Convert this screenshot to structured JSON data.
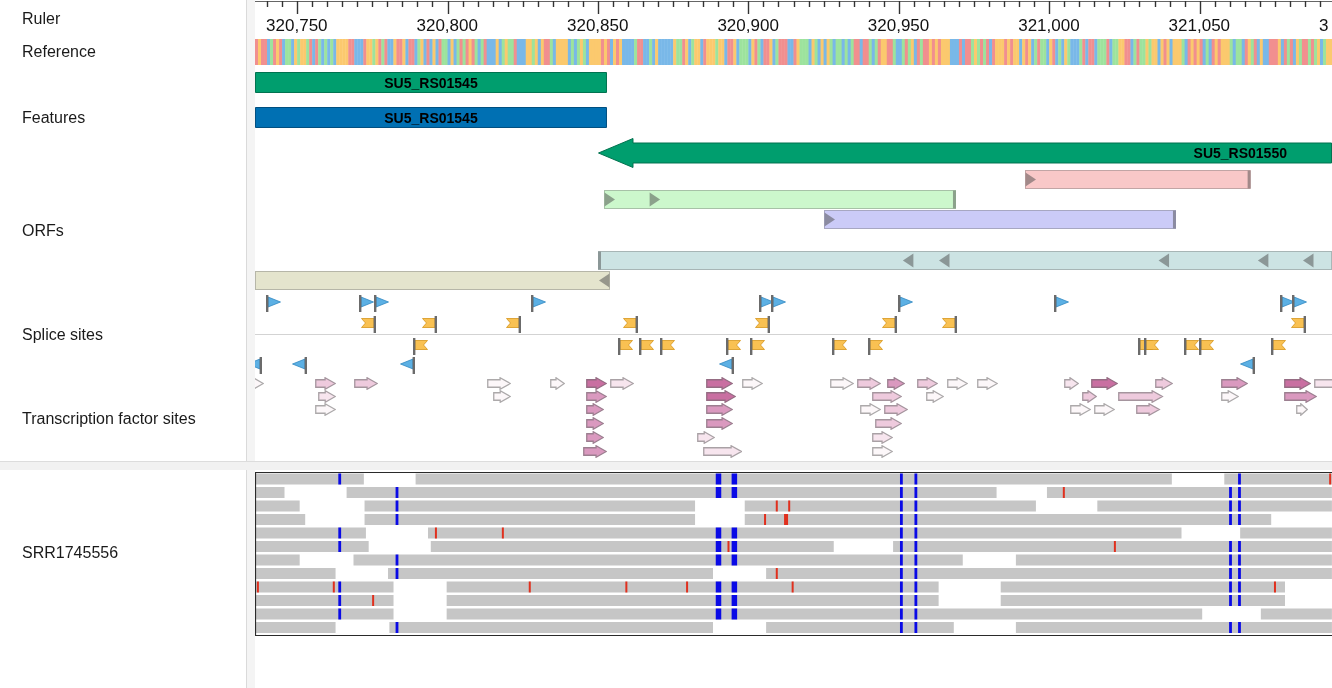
{
  "tracks": [
    {
      "kind": "ruler",
      "label": "Ruler",
      "ticks": [
        "320,750",
        "320,800",
        "320,850",
        "320,900",
        "320,950",
        "321,000",
        "321,050",
        "3"
      ]
    },
    {
      "kind": "reference",
      "label": "Reference"
    },
    {
      "kind": "features",
      "label": "Features",
      "features": [
        {
          "kind": "gene",
          "label": "SU5_RS01545",
          "reverse": true
        },
        {
          "kind": "cds",
          "label": "SU5_RS01545",
          "reverse": true
        },
        {
          "kind": "gene",
          "label": "SU5_RS01550",
          "reverse": true
        }
      ]
    },
    {
      "kind": "orfs",
      "label": "ORFs",
      "orfs": [
        {
          "color": "#f9c8c8",
          "reverse": false
        },
        {
          "color": "#ccf7cc",
          "reverse": false
        },
        {
          "color": "#cbcbf7",
          "reverse": false
        },
        {
          "color": "#cce3e3",
          "reverse": true
        },
        {
          "color": "#e4e4cd",
          "reverse": true
        }
      ]
    },
    {
      "kind": "splice_sites",
      "label": "Splice sites",
      "sites": [
        {
          "kind": "pennant",
          "reverse": false
        },
        {
          "kind": "pennant",
          "reverse": false
        },
        {
          "kind": "pennant",
          "reverse": false
        },
        {
          "kind": "pennant",
          "reverse": false
        },
        {
          "kind": "pennant",
          "reverse": false
        },
        {
          "kind": "pennant",
          "reverse": false
        },
        {
          "kind": "pennant",
          "reverse": false
        },
        {
          "kind": "pennant",
          "reverse": false
        },
        {
          "kind": "pennant",
          "reverse": false
        },
        {
          "kind": "pennant",
          "reverse": false
        },
        {
          "kind": "swallowtail",
          "reverse": false
        },
        {
          "kind": "swallowtail",
          "reverse": false
        },
        {
          "kind": "swallowtail",
          "reverse": false
        },
        {
          "kind": "swallowtail",
          "reverse": false
        },
        {
          "kind": "swallowtail",
          "reverse": false
        },
        {
          "kind": "swallowtail",
          "reverse": false
        },
        {
          "kind": "swallowtail",
          "reverse": false
        },
        {
          "kind": "swallowtail",
          "reverse": false
        },
        {
          "kind": "swallowtail",
          "reverse": true
        },
        {
          "kind": "swallowtail",
          "reverse": true
        },
        {
          "kind": "swallowtail",
          "reverse": true
        },
        {
          "kind": "swallowtail",
          "reverse": true
        },
        {
          "kind": "swallowtail",
          "reverse": true
        },
        {
          "kind": "swallowtail",
          "reverse": true
        },
        {
          "kind": "swallowtail",
          "reverse": true
        },
        {
          "kind": "swallowtail",
          "reverse": true
        },
        {
          "kind": "swallowtail",
          "reverse": true
        },
        {
          "kind": "swallowtail",
          "reverse": true
        },
        {
          "kind": "swallowtail",
          "reverse": true
        },
        {
          "kind": "swallowtail",
          "reverse": true
        },
        {
          "kind": "swallowtail",
          "reverse": true
        },
        {
          "kind": "pennant",
          "reverse": true
        },
        {
          "kind": "pennant",
          "reverse": true
        },
        {
          "kind": "pennant",
          "reverse": true
        },
        {
          "kind": "pennant",
          "reverse": true
        },
        {
          "kind": "pennant",
          "reverse": true
        }
      ]
    },
    {
      "kind": "tf_sites",
      "label": "Transcription factor sites",
      "sites": [
        {
          "color": "#fcf7f9"
        },
        {
          "color": "#eecadd"
        },
        {
          "color": "#eecadd"
        },
        {
          "color": "#fcf7f9"
        },
        {
          "color": "#fcf7f9"
        },
        {
          "color": "#c96fa1"
        },
        {
          "color": "#f7e5ee"
        },
        {
          "color": "#c96fa1"
        },
        {
          "color": "#fcf7f9"
        },
        {
          "color": "#fcf7f9"
        },
        {
          "color": "#eecadd"
        },
        {
          "color": "#da99bf"
        },
        {
          "color": "#eecadd"
        },
        {
          "color": "#fcf7f9"
        },
        {
          "color": "#fcf7f9"
        },
        {
          "color": "#f7e5ee"
        },
        {
          "color": "#c96fa1"
        },
        {
          "color": "#eecadd"
        },
        {
          "color": "#da99bf"
        },
        {
          "color": "#c96fa1"
        },
        {
          "color": "#f7e5ee"
        },
        {
          "color": "#f7e5ee"
        },
        {
          "color": "#fcf7f9"
        },
        {
          "color": "#da99bf"
        },
        {
          "color": "#c96fa1"
        },
        {
          "color": "#eecadd"
        },
        {
          "color": "#fcf7f9"
        },
        {
          "color": "#eecadd"
        },
        {
          "color": "#eecadd"
        },
        {
          "color": "#fcf7f9"
        },
        {
          "color": "#da99bf"
        },
        {
          "color": "#fcf7f9"
        },
        {
          "color": "#da99bf"
        },
        {
          "color": "#da99bf"
        },
        {
          "color": "#fcf7f9"
        },
        {
          "color": "#eecadd"
        },
        {
          "color": "#fcf7f9"
        },
        {
          "color": "#fcf7f9"
        },
        {
          "color": "#eecadd"
        },
        {
          "color": "#fcf7f9"
        },
        {
          "color": "#da99bf"
        },
        {
          "color": "#da99bf"
        },
        {
          "color": "#eecadd"
        },
        {
          "color": "#da99bf"
        },
        {
          "color": "#f7e5ee"
        },
        {
          "color": "#f7e5ee"
        },
        {
          "color": "#da99bf"
        },
        {
          "color": "#f7e5ee"
        },
        {
          "color": "#fcf7f9"
        }
      ]
    }
  ],
  "read_tracks": [
    {
      "label": "SRR1745556"
    }
  ]
}
